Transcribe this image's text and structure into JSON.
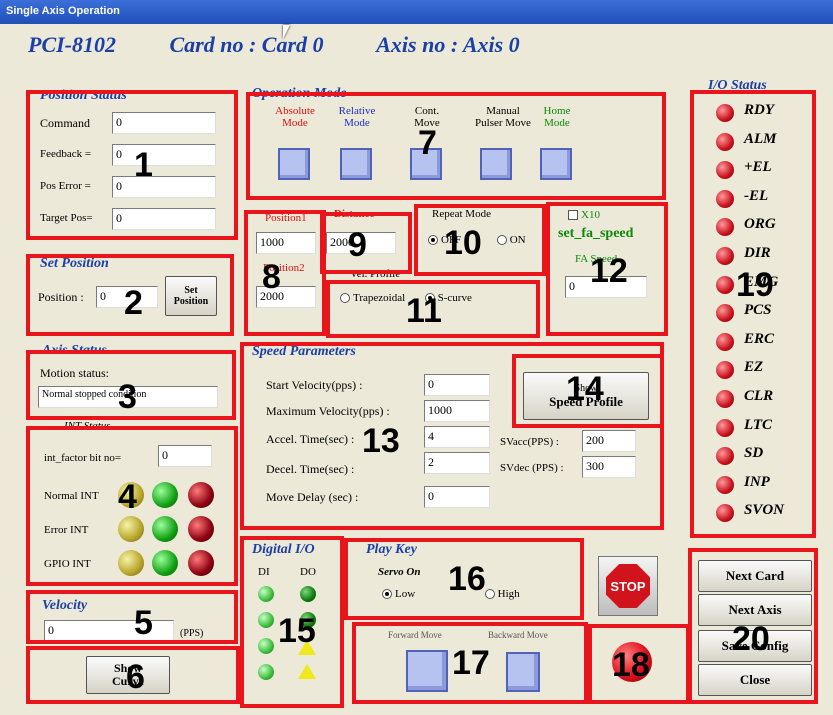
{
  "window": {
    "title": "Single Axis Operation"
  },
  "header": {
    "card_model": "PCI-8102",
    "card_no": "Card no : Card  0",
    "axis_no": "Axis no : Axis  0"
  },
  "position_status": {
    "title": "Position Status",
    "command_label": "Command",
    "command_value": "0",
    "feedback_label": "Feedback =",
    "feedback_value": "0",
    "pos_error_label": "Pos Error =",
    "pos_error_value": "0",
    "target_pos_label": "Target Pos=",
    "target_pos_value": "0"
  },
  "operation_mode": {
    "title": "Operation Mode",
    "modes": [
      {
        "l1": "Absolute",
        "l2": "Mode",
        "color": "#e01010"
      },
      {
        "l1": "Relative",
        "l2": "Mode",
        "color": "#1a2fc0"
      },
      {
        "l1": "Cont.",
        "l2": "Move",
        "color": "#000000"
      },
      {
        "l1": "Manual",
        "l2": "Pulser Move",
        "color": "#000000"
      },
      {
        "l1": "Home",
        "l2": "Mode",
        "color": "#0a8a0a"
      }
    ]
  },
  "io_status": {
    "title": "I/O Status",
    "items": [
      "RDY",
      "ALM",
      "+EL",
      "-EL",
      "ORG",
      "DIR",
      "EMG",
      "PCS",
      "ERC",
      "EZ",
      "CLR",
      "LTC",
      "SD",
      "INP",
      "SVON"
    ]
  },
  "set_position": {
    "title": "Set Position",
    "position_label": "Position :",
    "position_value": "0",
    "button": "Set\nPosition"
  },
  "positions": {
    "position1_label": "Position1",
    "position1_value": "1000",
    "position2_label": "Position2",
    "position2_value": "2000"
  },
  "distance": {
    "label": "Distance",
    "value": "2000"
  },
  "repeat_mode": {
    "title": "Repeat Mode",
    "off": "OFF",
    "on": "ON"
  },
  "velocity_profile": {
    "title": "Vel. Profile",
    "trapezoidal": "Trapezoidal",
    "s_curve": "S-curve"
  },
  "fa_speed": {
    "x10_label": "X10",
    "title": "set_fa_speed",
    "fa_label": "FA Speed",
    "value": "0"
  },
  "axis_status": {
    "title": "Axis Status",
    "motion_label": "Motion status:",
    "motion_value": "Normal stopped condition"
  },
  "speed_params": {
    "title": "Speed Parameters",
    "start_vel_label": "Start Velocity(pps) :",
    "start_vel_value": "0",
    "max_vel_label": "Maximum Velocity(pps) :",
    "max_vel_value": "1000",
    "accel_label": "Accel. Time(sec) :",
    "accel_value": "4",
    "decel_label": "Decel. Time(sec) :",
    "decel_value": "2",
    "delay_label": "Move Delay (sec) :",
    "delay_value": "0",
    "svacc_label": "SVacc(PPS) :",
    "svacc_value": "200",
    "svdec_label": "SVdec (PPS) :",
    "svdec_value": "300",
    "profile_button": "Speed Profile",
    "profile_top": "Show"
  },
  "int_status": {
    "title": "INT Status",
    "factor_label": "int_factor bit no=",
    "factor_value": "0",
    "normal_label": "Normal INT",
    "error_label": "Error INT",
    "gpio_label": "GPIO INT"
  },
  "velocity": {
    "title": "Velocity",
    "value": "0",
    "unit": "(PPS)"
  },
  "show_curve": {
    "button": "Show\nCurve"
  },
  "digital_io": {
    "title": "Digital I/O",
    "di": "DI",
    "do": "DO"
  },
  "play_key": {
    "title": "Play Key",
    "servo_on": "Servo On",
    "low": "Low",
    "high": "High"
  },
  "move": {
    "forward": "Forward Move",
    "backward": "Backward Move"
  },
  "stop": {
    "label": "STOP"
  },
  "right_buttons": {
    "next_card": "Next Card",
    "next_axis": "Next Axis",
    "save_config": "Save Config",
    "close": "Close"
  },
  "annotations": [
    "1",
    "2",
    "3",
    "4",
    "5",
    "6",
    "7",
    "8",
    "9",
    "10",
    "11",
    "12",
    "13",
    "14",
    "15",
    "16",
    "17",
    "18",
    "19",
    "20"
  ],
  "colors": {
    "annotation_box": "#e8161c",
    "group_title": "#1a3fa8",
    "background": "#ece9d8"
  }
}
